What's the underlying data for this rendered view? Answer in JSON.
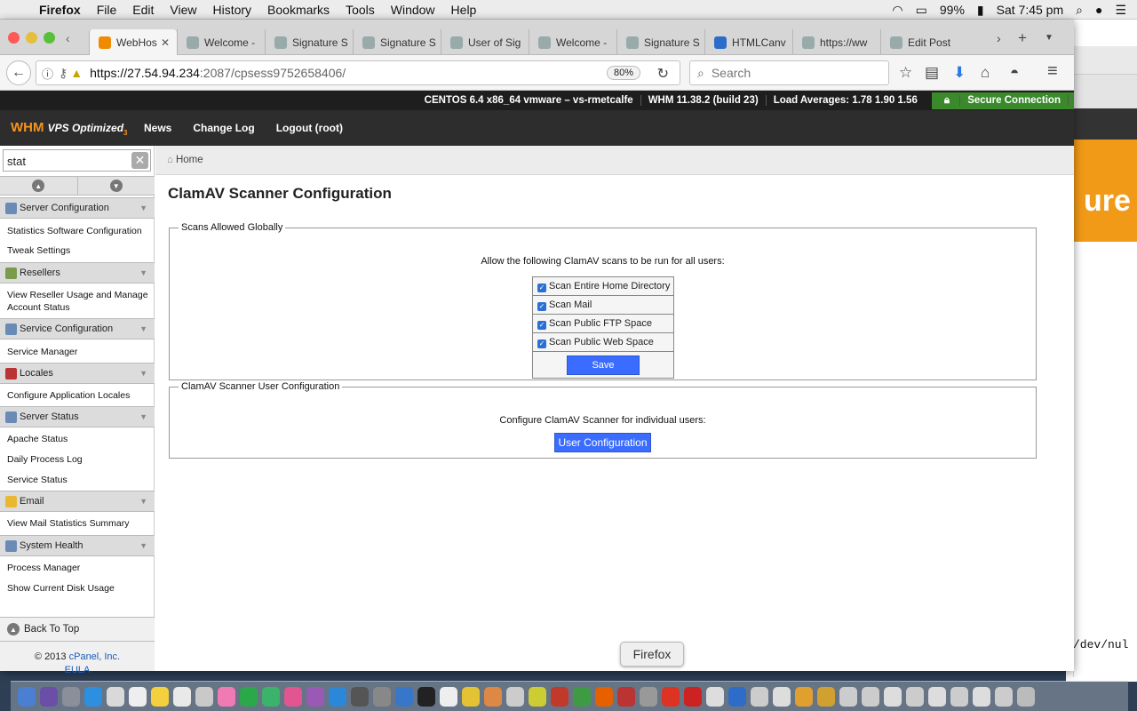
{
  "menubar": {
    "app": "Firefox",
    "items": [
      "File",
      "Edit",
      "View",
      "History",
      "Bookmarks",
      "Tools",
      "Window",
      "Help"
    ],
    "battery": "99%",
    "clock": "Sat 7:45 pm"
  },
  "background_window": {
    "logo_text": "ure",
    "terminal_line": "/dev/nul"
  },
  "browser": {
    "tabs": [
      {
        "label": "WebHos",
        "active": true
      },
      {
        "label": "Welcome -"
      },
      {
        "label": "Signature S"
      },
      {
        "label": "Signature S"
      },
      {
        "label": "User of Sig"
      },
      {
        "label": "Welcome -"
      },
      {
        "label": "Signature S"
      },
      {
        "label": "HTMLCanv"
      },
      {
        "label": "https://ww"
      },
      {
        "label": "Edit Post"
      }
    ],
    "url_host": "https://27.54.94.234",
    "url_path": ":2087/cpsess9752658406/",
    "zoom": "80%",
    "search_placeholder": "Search"
  },
  "whm": {
    "status": {
      "os": "CENTOS 6.4 x86_64 vmware – vs-rmetcalfe",
      "version": "WHM 11.38.2 (build 23)",
      "load": "Load Averages: 1.78 1.90 1.56",
      "secure": "Secure Connection"
    },
    "logo_main": "WHM",
    "logo_sub": "VPS Optimized",
    "logo_num": "3",
    "nav": [
      "News",
      "Change Log",
      "Logout (root)"
    ]
  },
  "sidebar": {
    "filter_value": "stat",
    "sections": [
      {
        "title": "Server Configuration",
        "items": [
          "Statistics Software Configuration",
          "Tweak Settings"
        ]
      },
      {
        "title": "Resellers",
        "items": [
          "View Reseller Usage and Manage Account Status"
        ]
      },
      {
        "title": "Service Configuration",
        "items": [
          "Service Manager"
        ]
      },
      {
        "title": "Locales",
        "items": [
          "Configure Application Locales"
        ]
      },
      {
        "title": "Server Status",
        "items": [
          "Apache Status",
          "Daily Process Log",
          "Service Status"
        ]
      },
      {
        "title": "Email",
        "items": [
          "View Mail Statistics Summary"
        ]
      },
      {
        "title": "System Health",
        "items": [
          "Process Manager",
          "Show Current Disk Usage"
        ]
      }
    ],
    "back_to_top": "Back To Top",
    "copyright": "© 2013",
    "cpanel_link": "cPanel, Inc.",
    "eula": "EULA"
  },
  "content": {
    "breadcrumb": "Home",
    "title": "ClamAV Scanner Configuration",
    "global": {
      "legend": "Scans Allowed Globally",
      "intro": "Allow the following ClamAV scans to be run for all users:",
      "options": [
        {
          "label": "Scan Entire Home Directory",
          "checked": true
        },
        {
          "label": "Scan Mail",
          "checked": true
        },
        {
          "label": "Scan Public FTP Space",
          "checked": true
        },
        {
          "label": "Scan Public Web Space",
          "checked": true
        }
      ],
      "save": "Save"
    },
    "user": {
      "legend": "ClamAV Scanner User Configuration",
      "intro": "Configure ClamAV Scanner for individual users:",
      "button": "User Configuration"
    }
  },
  "dock": {
    "tooltip": "Firefox"
  }
}
